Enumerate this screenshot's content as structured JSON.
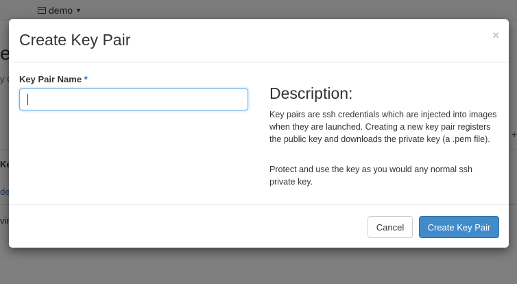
{
  "background": {
    "project_label": "demo",
    "heading_fragment": "e",
    "link_fragment": "y C",
    "column_fragment": "Ke",
    "row_link_fragment": "de",
    "row_text_fragment": "vin",
    "right_fragment": "+"
  },
  "modal": {
    "title": "Create Key Pair",
    "close_label": "×",
    "form": {
      "label": "Key Pair Name",
      "required_mark": "*",
      "value": "",
      "placeholder": ""
    },
    "description": {
      "title": "Description:",
      "paragraph1": "Key pairs are ssh credentials which are injected into images when they are launched. Creating a new key pair registers the public key and downloads the private key (a .pem file).",
      "paragraph2": "Protect and use the key as you would any normal ssh private key."
    },
    "footer": {
      "cancel_label": "Cancel",
      "create_label": "Create Key Pair"
    }
  }
}
